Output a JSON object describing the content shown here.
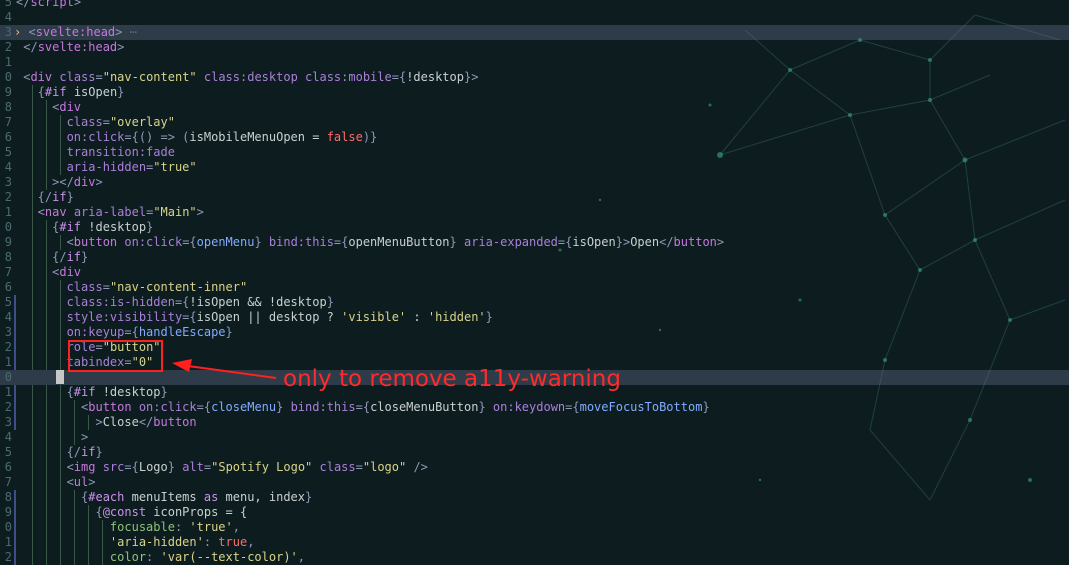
{
  "editor": {
    "lines": [
      {
        "n": "5",
        "tokens": [
          [
            "t-punct",
            "</"
          ],
          [
            "t-tag",
            "script"
          ],
          [
            "t-punct",
            ">"
          ]
        ]
      },
      {
        "n": "4",
        "tokens": []
      },
      {
        "n": "3",
        "hl": true,
        "fold": "›",
        "tokens": [
          [
            "t-punct",
            " <"
          ],
          [
            "t-tag",
            "svelte:head"
          ],
          [
            "t-punct",
            ">"
          ]
        ],
        "placeholder": " ⋯"
      },
      {
        "n": "2",
        "tokens": [
          [
            "t-punct",
            " </"
          ],
          [
            "t-tag",
            "svelte:head"
          ],
          [
            "t-punct",
            ">"
          ]
        ]
      },
      {
        "n": "1",
        "tokens": []
      },
      {
        "n": "0",
        "tokens": [
          [
            "t-punct",
            " <"
          ],
          [
            "t-tag",
            "div"
          ],
          [
            "t-attr",
            " class"
          ],
          [
            "t-punct",
            "="
          ],
          [
            "t-str",
            "\"nav-content\""
          ],
          [
            "t-attr",
            " class:desktop class:mobile"
          ],
          [
            "t-punct",
            "={"
          ],
          [
            "t-txt",
            "!desktop"
          ],
          [
            "t-punct",
            "}>"
          ]
        ]
      },
      {
        "n": "9",
        "tokens": [
          [
            "t-punct",
            "   {"
          ],
          [
            "t-kw",
            "#if"
          ],
          [
            "t-txt",
            " isOpen"
          ],
          [
            "t-punct",
            "}"
          ]
        ]
      },
      {
        "n": "8",
        "tokens": [
          [
            "t-punct",
            "     <"
          ],
          [
            "t-tag",
            "div"
          ]
        ]
      },
      {
        "n": "7",
        "tokens": [
          [
            "t-attr",
            "       class"
          ],
          [
            "t-punct",
            "="
          ],
          [
            "t-str",
            "\"overlay\""
          ]
        ]
      },
      {
        "n": "6",
        "tokens": [
          [
            "t-attr",
            "       on:click"
          ],
          [
            "t-punct",
            "={"
          ],
          [
            "t-punct",
            "() => ("
          ],
          [
            "t-txt",
            "isMobileMenuOpen = "
          ],
          [
            "t-bool",
            "false"
          ],
          [
            "t-punct",
            ")}"
          ]
        ]
      },
      {
        "n": "5",
        "tokens": [
          [
            "t-attr",
            "       transition:fade"
          ]
        ]
      },
      {
        "n": "4",
        "tokens": [
          [
            "t-attr",
            "       aria-hidden"
          ],
          [
            "t-punct",
            "="
          ],
          [
            "t-str",
            "\"true\""
          ]
        ]
      },
      {
        "n": "3",
        "tokens": [
          [
            "t-punct",
            "     ></"
          ],
          [
            "t-tag",
            "div"
          ],
          [
            "t-punct",
            ">"
          ]
        ]
      },
      {
        "n": "2",
        "tokens": [
          [
            "t-punct",
            "   {/"
          ],
          [
            "t-kw",
            "if"
          ],
          [
            "t-punct",
            "}"
          ]
        ]
      },
      {
        "n": "1",
        "tokens": [
          [
            "t-punct",
            "   <"
          ],
          [
            "t-tag",
            "nav"
          ],
          [
            "t-attr",
            " aria-label"
          ],
          [
            "t-punct",
            "="
          ],
          [
            "t-str",
            "\"Main\""
          ],
          [
            "t-punct",
            ">"
          ]
        ]
      },
      {
        "n": "0",
        "tokens": [
          [
            "t-punct",
            "     {"
          ],
          [
            "t-kw",
            "#if"
          ],
          [
            "t-txt",
            " !desktop"
          ],
          [
            "t-punct",
            "}"
          ]
        ]
      },
      {
        "n": "9",
        "tokens": [
          [
            "t-punct",
            "       <"
          ],
          [
            "t-tag",
            "button"
          ],
          [
            "t-attr",
            " on:click"
          ],
          [
            "t-punct",
            "={"
          ],
          [
            "t-fn",
            "openMenu"
          ],
          [
            "t-punct",
            "}"
          ],
          [
            "t-attr",
            " bind:this"
          ],
          [
            "t-punct",
            "={"
          ],
          [
            "t-txt",
            "openMenuButton"
          ],
          [
            "t-punct",
            "}"
          ],
          [
            "t-attr",
            " aria-expanded"
          ],
          [
            "t-punct",
            "={"
          ],
          [
            "t-txt",
            "isOpen"
          ],
          [
            "t-punct",
            "}>"
          ],
          [
            "t-txt",
            "Open"
          ],
          [
            "t-punct",
            "</"
          ],
          [
            "t-tag",
            "button"
          ],
          [
            "t-punct",
            ">"
          ]
        ]
      },
      {
        "n": "8",
        "tokens": [
          [
            "t-punct",
            "     {/"
          ],
          [
            "t-kw",
            "if"
          ],
          [
            "t-punct",
            "}"
          ]
        ]
      },
      {
        "n": "7",
        "tokens": [
          [
            "t-punct",
            "     <"
          ],
          [
            "t-tag",
            "div"
          ]
        ]
      },
      {
        "n": "6",
        "tokens": [
          [
            "t-attr",
            "       class"
          ],
          [
            "t-punct",
            "="
          ],
          [
            "t-str",
            "\"nav-content-inner\""
          ]
        ]
      },
      {
        "n": "5",
        "bar": true,
        "tokens": [
          [
            "t-attr",
            "       class:is-hidden"
          ],
          [
            "t-punct",
            "={"
          ],
          [
            "t-txt",
            "!isOpen && !desktop"
          ],
          [
            "t-punct",
            "}"
          ]
        ]
      },
      {
        "n": "4",
        "bar": true,
        "tokens": [
          [
            "t-attr",
            "       style:visibility"
          ],
          [
            "t-punct",
            "={"
          ],
          [
            "t-txt",
            "isOpen || desktop ? "
          ],
          [
            "t-str",
            "'visible'"
          ],
          [
            "t-txt",
            " : "
          ],
          [
            "t-str",
            "'hidden'"
          ],
          [
            "t-punct",
            "}"
          ]
        ]
      },
      {
        "n": "3",
        "bar": true,
        "tokens": [
          [
            "t-attr",
            "       on:keyup"
          ],
          [
            "t-punct",
            "={"
          ],
          [
            "t-fn",
            "handleEscape"
          ],
          [
            "t-punct",
            "}"
          ]
        ]
      },
      {
        "n": "2",
        "bar": true,
        "tokens": [
          [
            "t-attr",
            "       role"
          ],
          [
            "t-punct",
            "="
          ],
          [
            "t-str",
            "\"button\""
          ]
        ]
      },
      {
        "n": "1",
        "bar": true,
        "tokens": [
          [
            "t-attr",
            "       tabindex"
          ],
          [
            "t-punct",
            "="
          ],
          [
            "t-str",
            "\"0\""
          ]
        ]
      },
      {
        "n": "0",
        "hl": true,
        "cur": true,
        "tokens": []
      },
      {
        "n": "1",
        "bar": true,
        "tokens": [
          [
            "t-punct",
            "       {"
          ],
          [
            "t-kw",
            "#if"
          ],
          [
            "t-txt",
            " !desktop"
          ],
          [
            "t-punct",
            "}"
          ]
        ]
      },
      {
        "n": "2",
        "bar": true,
        "tokens": [
          [
            "t-punct",
            "         <"
          ],
          [
            "t-tag",
            "button"
          ],
          [
            "t-attr",
            " on:click"
          ],
          [
            "t-punct",
            "={"
          ],
          [
            "t-fn",
            "closeMenu"
          ],
          [
            "t-punct",
            "}"
          ],
          [
            "t-attr",
            " bind:this"
          ],
          [
            "t-punct",
            "={"
          ],
          [
            "t-txt",
            "closeMenuButton"
          ],
          [
            "t-punct",
            "}"
          ],
          [
            "t-attr",
            " on:keydown"
          ],
          [
            "t-punct",
            "={"
          ],
          [
            "t-fn",
            "moveFocusToBottom"
          ],
          [
            "t-punct",
            "}"
          ]
        ]
      },
      {
        "n": "3",
        "bar": true,
        "tokens": [
          [
            "t-punct",
            "           >"
          ],
          [
            "t-txt",
            "Close"
          ],
          [
            "t-punct",
            "</"
          ],
          [
            "t-tag",
            "button"
          ]
        ]
      },
      {
        "n": "4",
        "tokens": [
          [
            "t-punct",
            "         >"
          ]
        ]
      },
      {
        "n": "5",
        "tokens": [
          [
            "t-punct",
            "       {/"
          ],
          [
            "t-kw",
            "if"
          ],
          [
            "t-punct",
            "}"
          ]
        ]
      },
      {
        "n": "6",
        "tokens": [
          [
            "t-punct",
            "       <"
          ],
          [
            "t-tag",
            "img"
          ],
          [
            "t-attr",
            " src"
          ],
          [
            "t-punct",
            "={"
          ],
          [
            "t-txt",
            "Logo"
          ],
          [
            "t-punct",
            "}"
          ],
          [
            "t-attr",
            " alt"
          ],
          [
            "t-punct",
            "="
          ],
          [
            "t-str",
            "\"Spotify Logo\""
          ],
          [
            "t-attr",
            " class"
          ],
          [
            "t-punct",
            "="
          ],
          [
            "t-str",
            "\"logo\""
          ],
          [
            "t-punct",
            " />"
          ]
        ]
      },
      {
        "n": "7",
        "tokens": [
          [
            "t-punct",
            "       <"
          ],
          [
            "t-tag",
            "ul"
          ],
          [
            "t-punct",
            ">"
          ]
        ]
      },
      {
        "n": "8",
        "bar": true,
        "tokens": [
          [
            "t-punct",
            "         {"
          ],
          [
            "t-kw",
            "#each"
          ],
          [
            "t-txt",
            " menuItems "
          ],
          [
            "t-kw",
            "as"
          ],
          [
            "t-txt",
            " menu, index"
          ],
          [
            "t-punct",
            "}"
          ]
        ]
      },
      {
        "n": "9",
        "bar": true,
        "tokens": [
          [
            "t-punct",
            "           {"
          ],
          [
            "t-kw",
            "@const"
          ],
          [
            "t-txt",
            " iconProps = {"
          ]
        ]
      },
      {
        "n": "0",
        "bar": true,
        "tokens": [
          [
            "t-cm",
            "             focusable"
          ],
          [
            "t-punct",
            ": "
          ],
          [
            "t-str",
            "'true'"
          ],
          [
            "t-punct",
            ","
          ]
        ]
      },
      {
        "n": "1",
        "bar": true,
        "tokens": [
          [
            "t-str",
            "             'aria-hidden'"
          ],
          [
            "t-punct",
            ": "
          ],
          [
            "t-bool",
            "true"
          ],
          [
            "t-punct",
            ","
          ]
        ]
      },
      {
        "n": "2",
        "bar": true,
        "tokens": [
          [
            "t-cm",
            "             color"
          ],
          [
            "t-punct",
            ": "
          ],
          [
            "t-str",
            "'var(--text-color)'"
          ],
          [
            "t-punct",
            ","
          ]
        ]
      }
    ]
  },
  "annotation": {
    "text": "only to remove a11y-warning",
    "color": "#ff2020"
  },
  "colors": {
    "background": "#0d1d1f",
    "line_highlight": "#4b5573",
    "annotation": "#ff2020"
  }
}
